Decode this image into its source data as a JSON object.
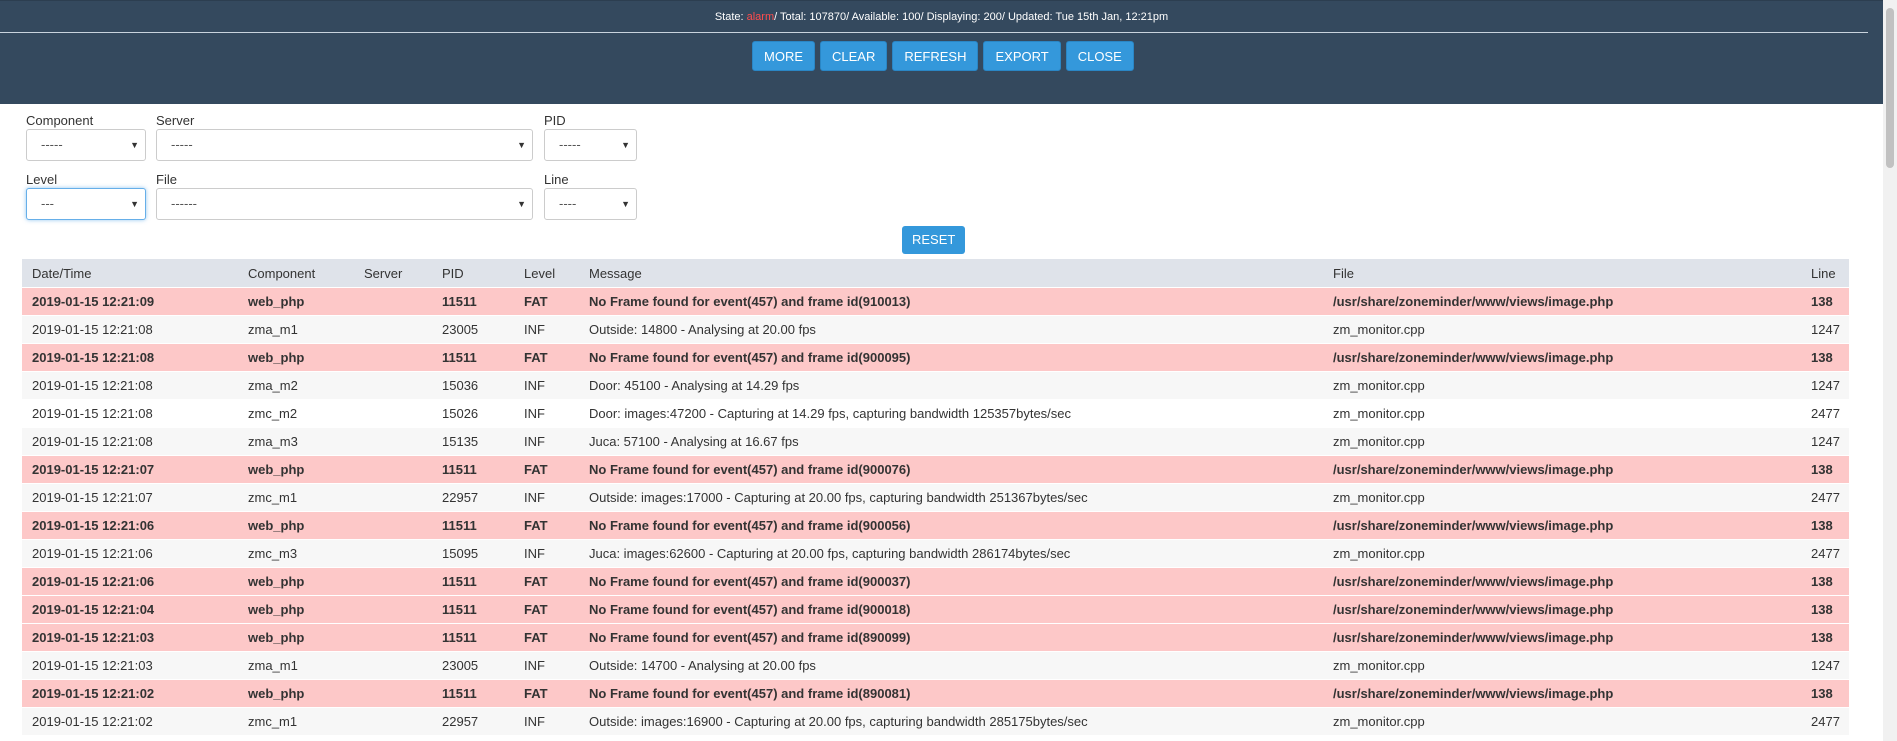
{
  "status": {
    "state_label": "State: ",
    "state_value": "alarm",
    "rest": "/ Total: 107870/ Available: 100/ Displaying: 200/ Updated: Tue 15th Jan, 12:21pm"
  },
  "toolbar": {
    "more": "MORE",
    "clear": "CLEAR",
    "refresh": "REFRESH",
    "export": "EXPORT",
    "close": "CLOSE"
  },
  "filters": {
    "component": {
      "label": "Component",
      "value": "-----"
    },
    "server": {
      "label": "Server",
      "value": "-----"
    },
    "pid": {
      "label": "PID",
      "value": "-----"
    },
    "level": {
      "label": "Level",
      "value": "---"
    },
    "file": {
      "label": "File",
      "value": "------"
    },
    "line": {
      "label": "Line",
      "value": "----"
    },
    "reset": "RESET"
  },
  "table": {
    "headers": [
      "Date/Time",
      "Component",
      "Server",
      "PID",
      "Level",
      "Message",
      "File",
      "Line"
    ],
    "rows": [
      [
        "2019-01-15 12:21:09",
        "web_php",
        "",
        "11511",
        "FAT",
        "No Frame found for event(457) and frame id(910013)",
        "/usr/share/zoneminder/www/views/image.php",
        "138"
      ],
      [
        "2019-01-15 12:21:08",
        "zma_m1",
        "",
        "23005",
        "INF",
        "Outside: 14800 - Analysing at 20.00 fps",
        "zm_monitor.cpp",
        "1247"
      ],
      [
        "2019-01-15 12:21:08",
        "web_php",
        "",
        "11511",
        "FAT",
        "No Frame found for event(457) and frame id(900095)",
        "/usr/share/zoneminder/www/views/image.php",
        "138"
      ],
      [
        "2019-01-15 12:21:08",
        "zma_m2",
        "",
        "15036",
        "INF",
        "Door: 45100 - Analysing at 14.29 fps",
        "zm_monitor.cpp",
        "1247"
      ],
      [
        "2019-01-15 12:21:08",
        "zmc_m2",
        "",
        "15026",
        "INF",
        "Door: images:47200 - Capturing at 14.29 fps, capturing bandwidth 125357bytes/sec",
        "zm_monitor.cpp",
        "2477"
      ],
      [
        "2019-01-15 12:21:08",
        "zma_m3",
        "",
        "15135",
        "INF",
        "Juca: 57100 - Analysing at 16.67 fps",
        "zm_monitor.cpp",
        "1247"
      ],
      [
        "2019-01-15 12:21:07",
        "web_php",
        "",
        "11511",
        "FAT",
        "No Frame found for event(457) and frame id(900076)",
        "/usr/share/zoneminder/www/views/image.php",
        "138"
      ],
      [
        "2019-01-15 12:21:07",
        "zmc_m1",
        "",
        "22957",
        "INF",
        "Outside: images:17000 - Capturing at 20.00 fps, capturing bandwidth 251367bytes/sec",
        "zm_monitor.cpp",
        "2477"
      ],
      [
        "2019-01-15 12:21:06",
        "web_php",
        "",
        "11511",
        "FAT",
        "No Frame found for event(457) and frame id(900056)",
        "/usr/share/zoneminder/www/views/image.php",
        "138"
      ],
      [
        "2019-01-15 12:21:06",
        "zmc_m3",
        "",
        "15095",
        "INF",
        "Juca: images:62600 - Capturing at 20.00 fps, capturing bandwidth 286174bytes/sec",
        "zm_monitor.cpp",
        "2477"
      ],
      [
        "2019-01-15 12:21:06",
        "web_php",
        "",
        "11511",
        "FAT",
        "No Frame found for event(457) and frame id(900037)",
        "/usr/share/zoneminder/www/views/image.php",
        "138"
      ],
      [
        "2019-01-15 12:21:04",
        "web_php",
        "",
        "11511",
        "FAT",
        "No Frame found for event(457) and frame id(900018)",
        "/usr/share/zoneminder/www/views/image.php",
        "138"
      ],
      [
        "2019-01-15 12:21:03",
        "web_php",
        "",
        "11511",
        "FAT",
        "No Frame found for event(457) and frame id(890099)",
        "/usr/share/zoneminder/www/views/image.php",
        "138"
      ],
      [
        "2019-01-15 12:21:03",
        "zma_m1",
        "",
        "23005",
        "INF",
        "Outside: 14700 - Analysing at 20.00 fps",
        "zm_monitor.cpp",
        "1247"
      ],
      [
        "2019-01-15 12:21:02",
        "web_php",
        "",
        "11511",
        "FAT",
        "No Frame found for event(457) and frame id(890081)",
        "/usr/share/zoneminder/www/views/image.php",
        "138"
      ],
      [
        "2019-01-15 12:21:02",
        "zmc_m1",
        "",
        "22957",
        "INF",
        "Outside: images:16900 - Capturing at 20.00 fps, capturing bandwidth 285175bytes/sec",
        "zm_monitor.cpp",
        "2477"
      ]
    ]
  }
}
